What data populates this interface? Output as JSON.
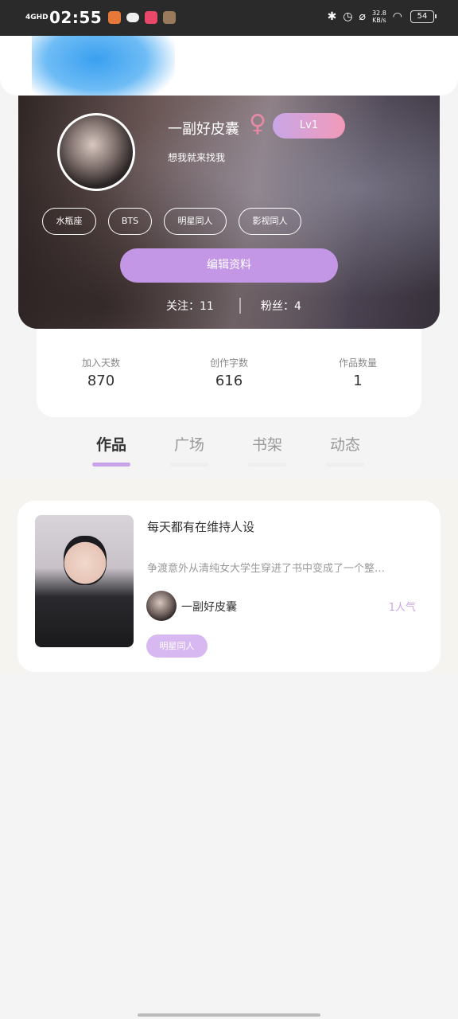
{
  "status_bar": {
    "network": "4GHD",
    "time": "02:55",
    "speed_value": "32.8",
    "speed_unit": "KB/s",
    "battery": "54"
  },
  "profile": {
    "username": "一副好皮囊",
    "gender_symbol": "♀",
    "level": "Lv1",
    "bio": "想我就来找我",
    "tags": [
      "水瓶座",
      "BTS",
      "明星同人",
      "影视同人"
    ],
    "edit_label": "编辑资料",
    "follow_label": "关注：11",
    "fans_label": "粉丝：4"
  },
  "stats": [
    {
      "label": "加入天数",
      "value": "870"
    },
    {
      "label": "创作字数",
      "value": "616"
    },
    {
      "label": "作品数量",
      "value": "1"
    }
  ],
  "tabs": [
    {
      "label": "作品",
      "active": true
    },
    {
      "label": "广场",
      "active": false
    },
    {
      "label": "书架",
      "active": false
    },
    {
      "label": "动态",
      "active": false
    }
  ],
  "works": [
    {
      "title": "每天都有在维持人设",
      "description": "争渡意外从清纯女大学生穿进了书中变成了一个整…",
      "author": "一副好皮囊",
      "popularity": "1人气",
      "tag": "明星同人"
    }
  ],
  "colors": {
    "accent": "#c497e6",
    "level_gradient_start": "#c8a6e8",
    "level_gradient_end": "#f29ab8",
    "gender": "#e88aa6"
  }
}
